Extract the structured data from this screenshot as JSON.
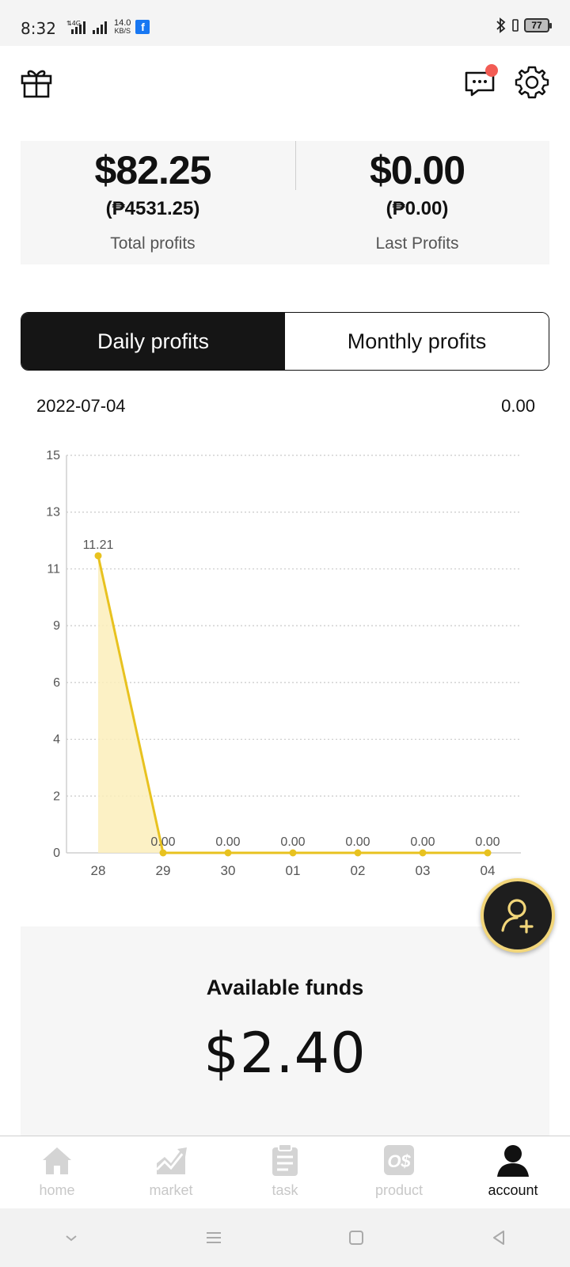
{
  "status_bar": {
    "time": "8:32",
    "speed_value": "14.0",
    "speed_unit": "KB/S",
    "battery": "77"
  },
  "header": {
    "icons": [
      "gift-icon",
      "message-icon",
      "gear-icon"
    ],
    "notification_dot_color": "#f25c54"
  },
  "profits": {
    "total": {
      "amount": "$82.25",
      "local": "(₱4531.25)",
      "label": "Total profits"
    },
    "last": {
      "amount": "$0.00",
      "local": "(₱0.00)",
      "label": "Last Profits"
    }
  },
  "tabs": [
    {
      "label": "Daily profits",
      "active": true
    },
    {
      "label": "Monthly profits",
      "active": false
    }
  ],
  "selected": {
    "date": "2022-07-04",
    "value": "0.00"
  },
  "chart_data": {
    "type": "line",
    "color": "#e8c21f",
    "fill_color": "#fbeebb",
    "y_ticks": [
      "0",
      "2",
      "4",
      "6",
      "9",
      "11",
      "13",
      "15"
    ],
    "ylim": [
      0,
      15
    ],
    "x": [
      "28",
      "29",
      "30",
      "01",
      "02",
      "03",
      "04"
    ],
    "values": [
      11.21,
      0,
      0,
      0,
      0,
      0,
      0
    ],
    "point_labels": [
      "11.21",
      "0.00",
      "0.00",
      "0.00",
      "0.00",
      "0.00",
      "0.00"
    ],
    "grid": "dotted horizontal"
  },
  "funds": {
    "label": "Available funds",
    "amount": "$2.40"
  },
  "bottom_nav": [
    {
      "label": "home",
      "icon": "home-icon",
      "active": false
    },
    {
      "label": "market",
      "icon": "chart-icon",
      "active": false
    },
    {
      "label": "task",
      "icon": "clipboard-icon",
      "active": false
    },
    {
      "label": "product",
      "icon": "product-icon",
      "active": false
    },
    {
      "label": "account",
      "icon": "user-icon",
      "active": true
    }
  ]
}
